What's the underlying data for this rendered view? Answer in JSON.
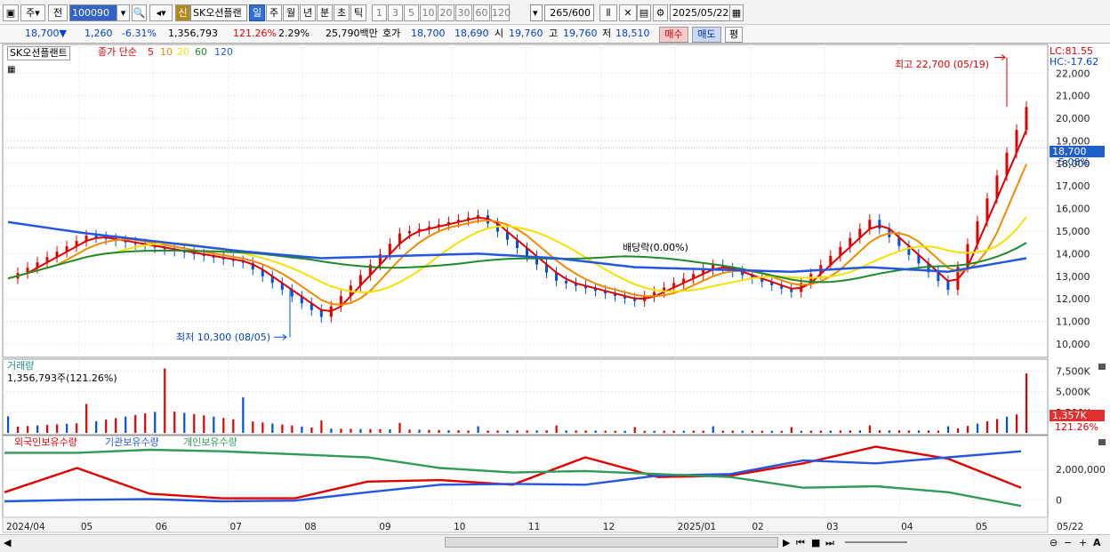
{
  "toolbar": {
    "market": "주",
    "prev": "전",
    "code": "100090",
    "name_button": "신",
    "stock_name": "SK오션플랜",
    "periods": [
      "일",
      "주",
      "월",
      "년",
      "분",
      "초",
      "틱"
    ],
    "active_period": "일",
    "intervals": [
      "1",
      "3",
      "5",
      "10",
      "20",
      "30",
      "60",
      "120"
    ],
    "count": "265/600",
    "date": "2025/05/22"
  },
  "quote": {
    "price": "18,700▼",
    "change": "1,260",
    "change_pct": "-6.31%",
    "volume": "1,356,793",
    "volume_ratio": "121.26%",
    "turnover": "2.29%",
    "amount": "25,790백만",
    "ask_label": "호가",
    "ask": "18,700",
    "bid": "18,690",
    "open_label": "시",
    "open": "19,760",
    "high_label": "고",
    "high": "19,760",
    "low_label": "저",
    "low": "18,510",
    "buy": "매수",
    "sell": "매도",
    "eval": "평"
  },
  "price_panel": {
    "stock_label": "SK오션플랜트",
    "ma_label": "종가 단순",
    "ma_periods": [
      "5",
      "10",
      "20",
      "60",
      "120"
    ],
    "lc": "LC:81.55",
    "hc": "HC:-17.62",
    "current": "18,700",
    "current_pct": "-5.08%",
    "max_note": "최고 22,700 (05/19)",
    "min_note": "최저 10,300 (08/05)",
    "dividend_note": "배당락(0.00%)",
    "y_ticks": [
      "22,000",
      "21,000",
      "20,000",
      "19,000",
      "18,000",
      "17,000",
      "16,000",
      "15,000",
      "14,000",
      "13,000",
      "12,000",
      "11,000",
      "10,000"
    ]
  },
  "volume_panel": {
    "title": "거래량",
    "value": "1,356,793주(121.26%)",
    "y_ticks": [
      "7,500K",
      "5,000K",
      "2,500K"
    ],
    "current": "1,357K",
    "current_pct": "121.26%"
  },
  "holding_panel": {
    "legend": [
      "외국인보유수량",
      "기관보유수량",
      "개인보유수량"
    ],
    "y_ticks": [
      "2,000,000",
      "0"
    ]
  },
  "x_labels": [
    "2024/04",
    "05",
    "06",
    "07",
    "08",
    "09",
    "10",
    "11",
    "12",
    "2025/01",
    "02",
    "03",
    "04",
    "05",
    "05/22"
  ],
  "colors": {
    "up": "#e00000",
    "down": "#0050e0",
    "ma5": "#e00000",
    "ma10": "#f08a00",
    "ma20": "#f5e000",
    "ma60": "#1f8a2a",
    "ma120": "#2456e0",
    "foreign": "#e00000",
    "institution": "#2456e0",
    "individual": "#2f9a5a"
  },
  "chart_data": {
    "type": "line",
    "title": "SK오션플랜트",
    "x": [
      "2024/04",
      "05",
      "06",
      "07",
      "08",
      "09",
      "10",
      "11",
      "12",
      "2025/01",
      "02",
      "03",
      "04",
      "05"
    ],
    "series": [
      {
        "name": "종가",
        "values": [
          12900,
          14800,
          14200,
          13600,
          11200,
          14900,
          15700,
          12800,
          11900,
          13500,
          12300,
          15500,
          12400,
          20500
        ]
      },
      {
        "name": "120",
        "values": [
          15400,
          14900,
          14500,
          14100,
          13800,
          13900,
          14000,
          13800,
          13400,
          13300,
          13200,
          13400,
          13200,
          13800
        ]
      }
    ],
    "max": {
      "value": 22700,
      "date": "05/19"
    },
    "min": {
      "value": 10300,
      "date": "08/05"
    },
    "ylim": [
      9800,
      22800
    ],
    "volume": [
      2000,
      3500,
      7800,
      4300,
      1500,
      1200,
      800,
      900,
      700,
      800,
      700,
      900,
      800,
      7200
    ],
    "volume_unit": "K",
    "holdings": {
      "x": [
        "2024/04",
        "05",
        "06",
        "07",
        "08",
        "09",
        "10",
        "11",
        "12",
        "2025/01",
        "02",
        "03",
        "04",
        "05",
        "05/22"
      ],
      "foreign": [
        500000,
        2100000,
        400000,
        100000,
        100000,
        1200000,
        1300000,
        1000000,
        2800000,
        1500000,
        1600000,
        2400000,
        3500000,
        2700000,
        800000
      ],
      "institution": [
        -100000,
        0,
        50000,
        -100000,
        -50000,
        500000,
        1000000,
        1050000,
        1000000,
        1600000,
        1700000,
        2600000,
        2400000,
        2800000,
        3200000
      ],
      "individual": [
        3100000,
        3100000,
        3300000,
        3200000,
        3000000,
        2800000,
        2100000,
        1800000,
        1900000,
        1700000,
        1500000,
        800000,
        900000,
        500000,
        -400000
      ]
    }
  }
}
